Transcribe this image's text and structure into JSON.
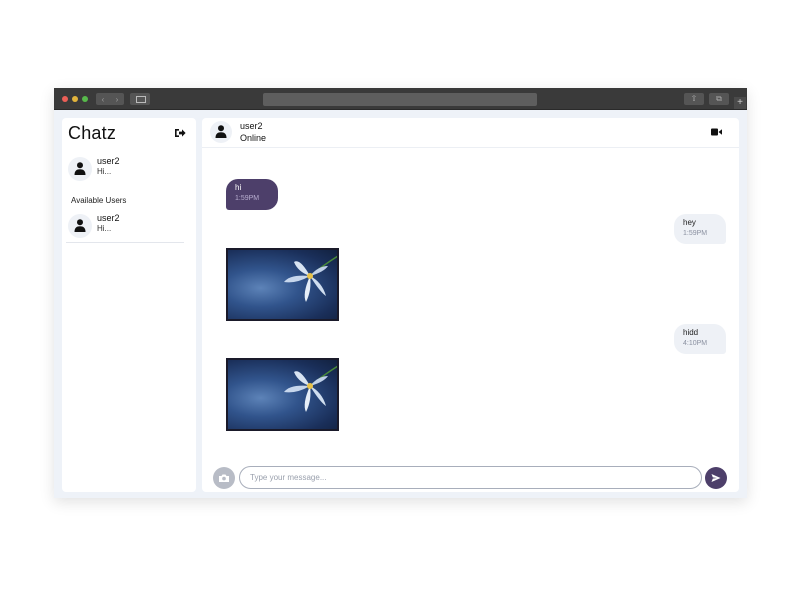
{
  "sidebar": {
    "title": "Chatz",
    "recent_chat": {
      "name": "user2",
      "preview": "Hi..."
    },
    "available_label": "Available Users",
    "available_users": [
      {
        "name": "user2",
        "preview": "Hi..."
      }
    ]
  },
  "chat_header": {
    "name": "user2",
    "status": "Online"
  },
  "messages": [
    {
      "direction": "received",
      "type": "text",
      "text": "hi",
      "time": "1:59PM"
    },
    {
      "direction": "sent",
      "type": "text",
      "text": "hey",
      "time": "1:59PM"
    },
    {
      "direction": "received",
      "type": "image",
      "alt": "white lily flower on blue background"
    },
    {
      "direction": "sent",
      "type": "text",
      "text": "hidd",
      "time": "4:10PM"
    },
    {
      "direction": "received",
      "type": "image",
      "alt": "white lily flower on blue background"
    }
  ],
  "composer": {
    "placeholder": "Type your message..."
  },
  "colors": {
    "accent": "#4d3f6a",
    "sent_bubble": "#eef1f6",
    "panel_bg": "#eef2f8"
  },
  "icons": {
    "logout": "logout-icon",
    "user": "user-icon",
    "video": "video-camera-icon",
    "camera": "camera-icon",
    "send": "send-icon"
  }
}
